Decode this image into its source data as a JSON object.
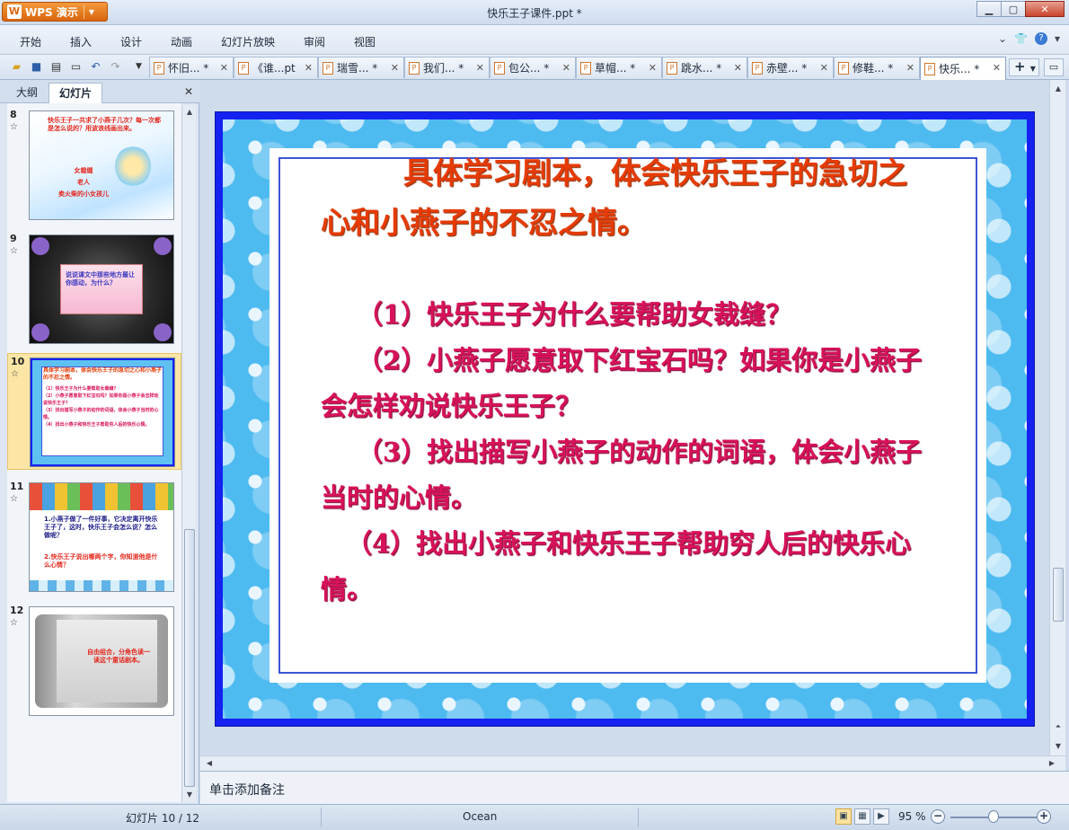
{
  "window": {
    "app_button": "WPS 演示",
    "title": "快乐王子课件.ppt *"
  },
  "menu": [
    "开始",
    "插入",
    "设计",
    "动画",
    "幻灯片放映",
    "审阅",
    "视图"
  ],
  "tabs": [
    {
      "label": "怀旧... *"
    },
    {
      "label": "《谁...pt"
    },
    {
      "label": "瑞雪... *"
    },
    {
      "label": "我们... *"
    },
    {
      "label": "包公... *"
    },
    {
      "label": "草帽... *"
    },
    {
      "label": "跳水... *"
    },
    {
      "label": "赤壁... *"
    },
    {
      "label": "修鞋... *"
    },
    {
      "label": "快乐... *"
    }
  ],
  "panel": {
    "tab_outline": "大纲",
    "tab_slides": "幻灯片",
    "slides": [
      {
        "num": "8",
        "star": "☆",
        "text1": "快乐王子一共求了小燕子几次？每一次都是怎么说的？用波浪线画出来。",
        "text2": "女裁缝\n老人\n卖火柴的小女孩儿"
      },
      {
        "num": "9",
        "star": "☆",
        "text1": "说说课文中那些地方最让你感动，为什么？",
        "text2": ""
      },
      {
        "num": "10",
        "star": "☆",
        "text1": "具体学习剧本，体会快乐王子的急切之心和小燕子的不忍之情。",
        "text2": "（1）快乐王子为什么要帮助女裁缝？\n（2）小燕子愿意取下红宝石吗？如果你是小燕子会怎样劝说快乐王子？\n（3）找出描写小燕子的动作的词语，体会小燕子当时的心情。\n（4）找出小燕子和快乐王子帮助穷人后的快乐心情。"
      },
      {
        "num": "11",
        "star": "☆",
        "text1": "1.小燕子做了一件好事，它决定离开快乐王子了，这时，快乐王子会怎么说？怎么做呢？",
        "text2": "2.快乐王子说出哪两个字，你知道他是什么心情？"
      },
      {
        "num": "12",
        "star": "☆",
        "text1": "自由组合，分角色读一读这个童话剧本。",
        "text2": ""
      }
    ]
  },
  "slide": {
    "title": "具体学习剧本，体会快乐王子的急切之心和小燕子的不忍之情。",
    "items": [
      "（1）快乐王子为什么要帮助女裁缝？",
      "（2）小燕子愿意取下红宝石吗？如果你是小燕子会怎样劝说快乐王子？",
      "（3）找出描写小燕子的动作的词语，体会小燕子当时的心情。",
      "（4）找出小燕子和快乐王子帮助穷人后的快乐心情。"
    ]
  },
  "notes": {
    "placeholder": "单击添加备注"
  },
  "status": {
    "slide_counter": "幻灯片 10 / 12",
    "theme": "Ocean",
    "zoom": "95 %",
    "zoom_level": 0.5
  },
  "colors": {
    "title_color": "#e63b06",
    "body_color": "#d8125a",
    "frame_blue": "#1421f0",
    "pattern_blue": "#4dbaf0"
  }
}
